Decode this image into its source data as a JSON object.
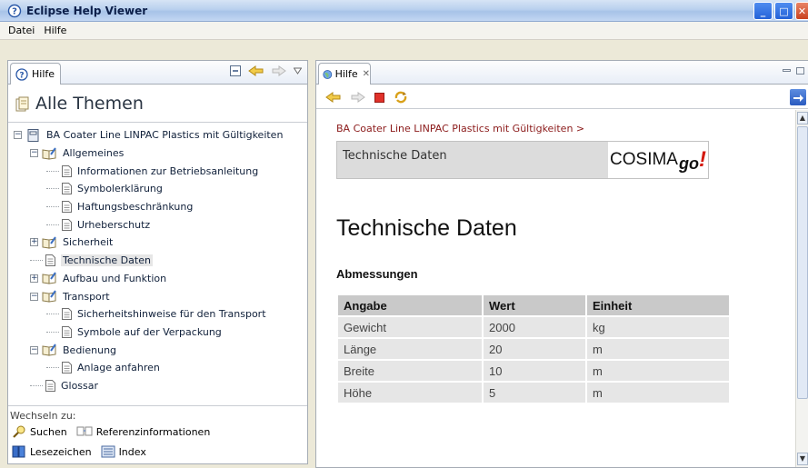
{
  "window": {
    "title": "Eclipse Help Viewer"
  },
  "menubar": {
    "items": [
      "Datei",
      "Hilfe"
    ]
  },
  "left_view": {
    "tab_label": "Hilfe",
    "heading": "Alle Themen",
    "tree": [
      {
        "label": "BA Coater Line LINPAC Plastics mit Gültigkeiten",
        "level": 0,
        "icon": "book-closed-icon",
        "expander": "minus"
      },
      {
        "label": "Allgemeines",
        "level": 1,
        "icon": "book-open-icon",
        "expander": "minus"
      },
      {
        "label": "Informationen zur Betriebsanleitung",
        "level": 2,
        "icon": "page-icon",
        "expander": "none"
      },
      {
        "label": "Symbolerklärung",
        "level": 2,
        "icon": "page-icon",
        "expander": "none"
      },
      {
        "label": "Haftungsbeschränkung",
        "level": 2,
        "icon": "page-icon",
        "expander": "none"
      },
      {
        "label": "Urheberschutz",
        "level": 2,
        "icon": "page-icon",
        "expander": "none"
      },
      {
        "label": "Sicherheit",
        "level": 1,
        "icon": "book-open-icon",
        "expander": "plus"
      },
      {
        "label": "Technische Daten",
        "level": 1,
        "icon": "page-icon",
        "expander": "none",
        "selected": true
      },
      {
        "label": "Aufbau und Funktion",
        "level": 1,
        "icon": "book-open-icon",
        "expander": "plus"
      },
      {
        "label": "Transport",
        "level": 1,
        "icon": "book-open-icon",
        "expander": "minus"
      },
      {
        "label": "Sicherheitshinweise für den Transport",
        "level": 2,
        "icon": "page-icon",
        "expander": "none"
      },
      {
        "label": "Symbole auf der Verpackung",
        "level": 2,
        "icon": "page-icon",
        "expander": "none"
      },
      {
        "label": "Bedienung",
        "level": 1,
        "icon": "book-open-icon",
        "expander": "minus"
      },
      {
        "label": "Anlage anfahren",
        "level": 2,
        "icon": "page-icon",
        "expander": "none"
      },
      {
        "label": "Glossar",
        "level": 1,
        "icon": "page-icon",
        "expander": "none"
      }
    ],
    "switch": {
      "caption": "Wechseln zu:",
      "search": "Suchen",
      "references": "Referenzinformationen",
      "bookmarks": "Lesezeichen",
      "index": "Index"
    }
  },
  "right_view": {
    "tab_label": "Hilfe",
    "breadcrumb": "BA Coater Line LINPAC Plastics mit Gültigkeiten >",
    "section_label": "Technische Daten",
    "logo_text": "COSIMA",
    "logo_go": "go",
    "logo_bang": "!",
    "title": "Technische Daten",
    "subtitle": "Abmessungen",
    "table": {
      "headers": [
        "Angabe",
        "Wert",
        "Einheit"
      ],
      "rows": [
        [
          "Gewicht",
          "2000",
          "kg"
        ],
        [
          "Länge",
          "20",
          "m"
        ],
        [
          "Breite",
          "10",
          "m"
        ],
        [
          "Höhe",
          "5",
          "m"
        ]
      ]
    }
  },
  "colors": {
    "breadcrumb": "#8b1a1a",
    "logo_accent": "#d41a10",
    "title_bar": "#b9d0ee"
  }
}
